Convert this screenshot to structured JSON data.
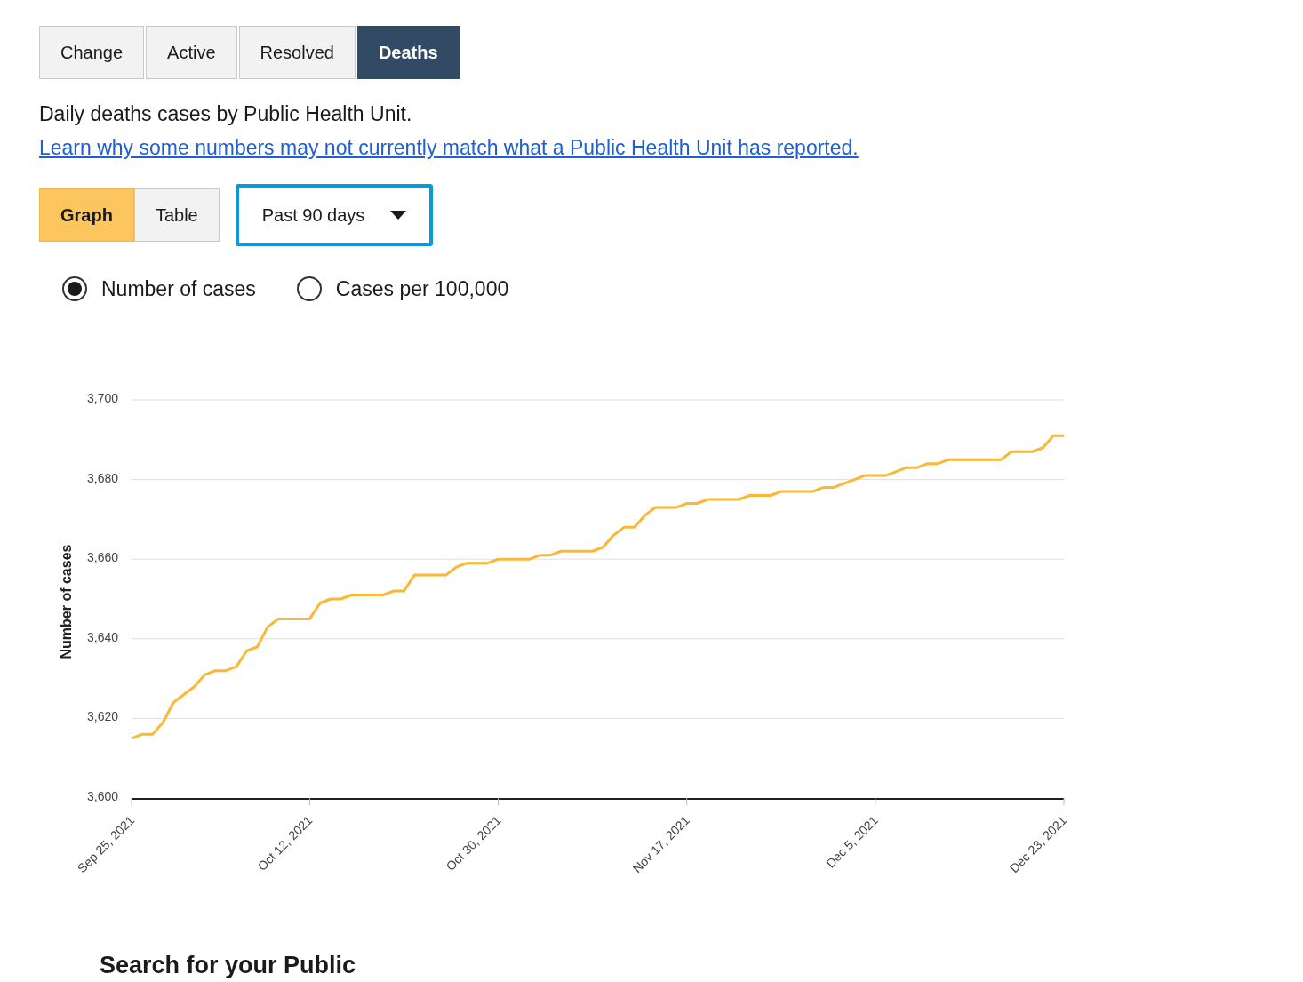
{
  "tabs": [
    {
      "label": "Change",
      "selected": false
    },
    {
      "label": "Active",
      "selected": false
    },
    {
      "label": "Resolved",
      "selected": false
    },
    {
      "label": "Deaths",
      "selected": true
    }
  ],
  "description": {
    "text": "Daily deaths cases by Public Health Unit.",
    "link": "Learn why some numbers may not currently match what a Public Health Unit has reported."
  },
  "view_toggle": [
    {
      "label": "Graph",
      "selected": true
    },
    {
      "label": "Table",
      "selected": false
    }
  ],
  "range_select": {
    "value": "Past 90 days"
  },
  "measure_options": [
    {
      "label": "Number of cases",
      "selected": true
    },
    {
      "label": "Cases per 100,000",
      "selected": false
    }
  ],
  "chart": {
    "chart_data": {
      "type": "line",
      "ylabel": "Number of cases",
      "ylim": [
        3600,
        3700
      ],
      "yticks": [
        {
          "value": 3600,
          "label": "3,600"
        },
        {
          "value": 3620,
          "label": "3,620"
        },
        {
          "value": 3640,
          "label": "3,640"
        },
        {
          "value": 3660,
          "label": "3,660"
        },
        {
          "value": 3680,
          "label": "3,680"
        },
        {
          "value": 3700,
          "label": "3,700"
        }
      ],
      "grid": true,
      "categories": [
        "Sep 25, 2021",
        null,
        null,
        null,
        null,
        null,
        null,
        null,
        null,
        null,
        null,
        null,
        null,
        null,
        null,
        null,
        null,
        "Oct 12, 2021",
        null,
        null,
        null,
        null,
        null,
        null,
        null,
        null,
        null,
        null,
        null,
        null,
        null,
        null,
        null,
        null,
        null,
        "Oct 30, 2021",
        null,
        null,
        null,
        null,
        null,
        null,
        null,
        null,
        null,
        null,
        null,
        null,
        null,
        null,
        null,
        null,
        null,
        "Nov 17, 2021",
        null,
        null,
        null,
        null,
        null,
        null,
        null,
        null,
        null,
        null,
        null,
        null,
        null,
        null,
        null,
        null,
        null,
        "Dec 5, 2021",
        null,
        null,
        null,
        null,
        null,
        null,
        null,
        null,
        null,
        null,
        null,
        null,
        null,
        null,
        null,
        null,
        null,
        "Dec 23, 2021"
      ],
      "series": [
        {
          "color": "#fbb735",
          "values": [
            3615,
            3616,
            3616,
            3619,
            3624,
            3626,
            3628,
            3631,
            3632,
            3632,
            3633,
            3637,
            3638,
            3643,
            3645,
            3645,
            3645,
            3645,
            3649,
            3650,
            3650,
            3651,
            3651,
            3651,
            3651,
            3652,
            3652,
            3656,
            3656,
            3656,
            3656,
            3658,
            3659,
            3659,
            3659,
            3660,
            3660,
            3660,
            3660,
            3661,
            3661,
            3662,
            3662,
            3662,
            3662,
            3663,
            3666,
            3668,
            3668,
            3671,
            3673,
            3673,
            3673,
            3674,
            3674,
            3675,
            3675,
            3675,
            3675,
            3676,
            3676,
            3676,
            3677,
            3677,
            3677,
            3677,
            3678,
            3678,
            3679,
            3680,
            3681,
            3681,
            3681,
            3682,
            3683,
            3683,
            3684,
            3684,
            3685,
            3685,
            3685,
            3685,
            3685,
            3685,
            3687,
            3687,
            3687,
            3688,
            3691,
            3691
          ]
        }
      ]
    }
  },
  "next_heading": "Search for your Public"
}
